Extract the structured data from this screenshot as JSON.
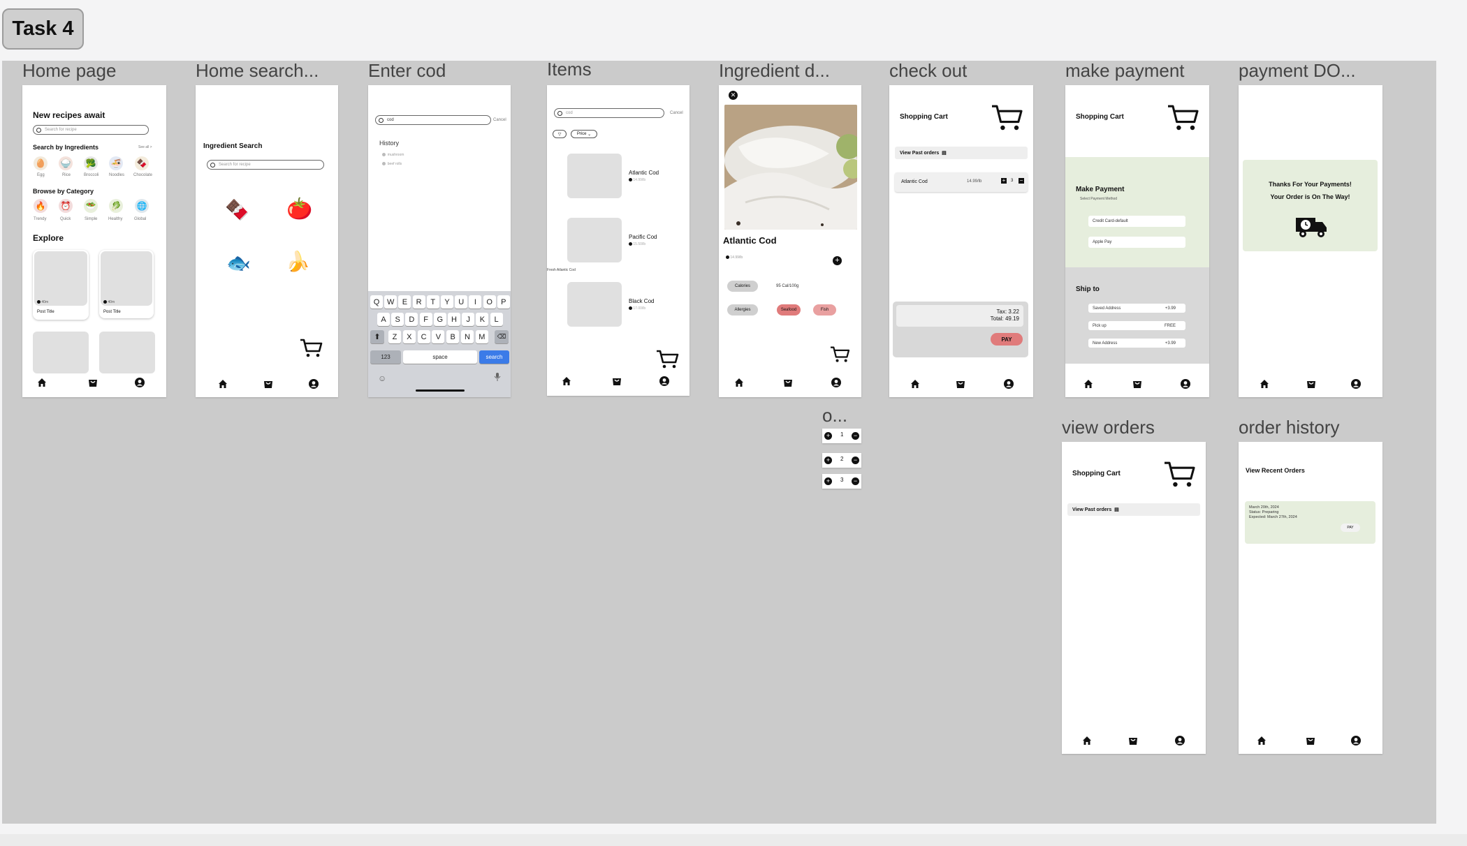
{
  "task_label": "Task 4",
  "frames": {
    "home": "Home page",
    "home_search": "Home search...",
    "enter_cod": "Enter cod",
    "items": "Items",
    "ingredient": "Ingredient d...",
    "checkout": "check out",
    "make_payment": "make payment",
    "payment_done": "payment DO...",
    "o_component": "o...",
    "view_orders": "view orders",
    "order_history": "order history"
  },
  "home": {
    "title": "New recipes await",
    "search_placeholder": "Search for recipe",
    "by_ingredients": "Search by Ingredients",
    "see_all": "See all >",
    "ingredients": [
      "Egg",
      "Rice",
      "Broccoli",
      "Noodles",
      "Chocolate"
    ],
    "browse": "Browse by Category",
    "categories": [
      "Trendy",
      "Quick",
      "Simple",
      "Healthy",
      "Global"
    ],
    "explore": "Explore",
    "posts": [
      {
        "title": "Post Title",
        "meta": "40m"
      },
      {
        "title": "Post Title",
        "meta": "40m"
      }
    ]
  },
  "home_search": {
    "title": "Ingredient Search",
    "search_placeholder": "Search for recipe",
    "emojis": [
      "🍫",
      "🍅",
      "🐟",
      "🍌"
    ]
  },
  "enter_cod": {
    "query": "cod",
    "cancel": "Cancel",
    "history_label": "History",
    "history": [
      "mushroom",
      "beef rolls"
    ],
    "kb_row1": [
      "Q",
      "W",
      "E",
      "R",
      "T",
      "Y",
      "U",
      "I",
      "O",
      "P"
    ],
    "kb_row2": [
      "A",
      "S",
      "D",
      "F",
      "G",
      "H",
      "J",
      "K",
      "L"
    ],
    "kb_row3": [
      "Z",
      "X",
      "C",
      "V",
      "B",
      "N",
      "M"
    ],
    "key_123": "123",
    "key_space": "space",
    "key_search": "search"
  },
  "items": {
    "query": "cod",
    "cancel": "Cancel",
    "filter": "Price",
    "list": [
      {
        "name": "Atlantic Cod",
        "price": "14.99/lb"
      },
      {
        "name": "Pacific Cod",
        "price": "15.50/lb"
      },
      {
        "name": "Black Cod",
        "price": "17.00/lb"
      }
    ],
    "note": "Fresh Atlantic Cod"
  },
  "ingredient": {
    "name": "Atlantic Cod",
    "price": "14.99/lb",
    "calories_label": "Calories",
    "calories_value": "95 Cal/100g",
    "allergies_label": "Allergies",
    "tags": [
      "Seafood",
      "Fish"
    ]
  },
  "checkout": {
    "title": "Shopping Cart",
    "past_orders": "View Past orders",
    "item_name": "Atlantic Cod",
    "item_price": "14.99/lb",
    "qty": "3",
    "tax": "Tax: 3.22",
    "total": "Total: 49.19",
    "pay": "PAY"
  },
  "make_payment": {
    "title": "Shopping Cart",
    "heading": "Make Payment",
    "sub": "Select Payment Method",
    "methods": [
      "Credit Card-default",
      "Apple Pay"
    ],
    "ship_to": "Ship to",
    "ship_options": [
      {
        "label": "Saved Address",
        "price": "+3.99"
      },
      {
        "label": "Pick up",
        "price": "FREE"
      },
      {
        "label": "New Address",
        "price": "+3.99"
      }
    ]
  },
  "payment_done": {
    "line1": "Thanks For Your Payments!",
    "line2": "Your Order is On The Way!"
  },
  "o_component": {
    "values": [
      "1",
      "2",
      "3"
    ]
  },
  "view_orders": {
    "title": "Shopping Cart",
    "past_orders": "View Past orders"
  },
  "order_history": {
    "title": "View Recent Orders",
    "date": "March 20th, 2024",
    "status": "Status: Preparing",
    "expected": "Expected: March 27th, 2024",
    "pay": "PAY"
  },
  "colors": {
    "canvas": "#cbcbcb",
    "accent_red": "#e07b7b",
    "mint": "#e6eedd",
    "search_blue": "#3b7be8"
  },
  "icons": [
    "home-icon",
    "bag-icon",
    "profile-icon",
    "cart-icon",
    "truck-icon",
    "close-icon",
    "plus-icon",
    "minus-icon",
    "search-icon"
  ]
}
